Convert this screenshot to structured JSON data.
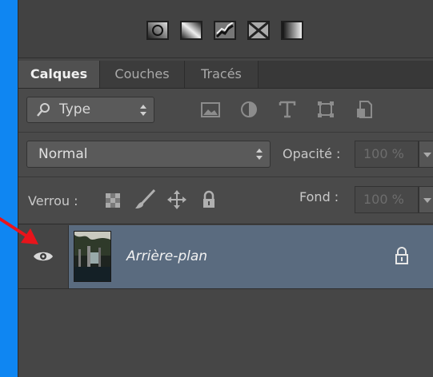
{
  "tabs": [
    {
      "label": "Calques",
      "active": true
    },
    {
      "label": "Couches",
      "active": false
    },
    {
      "label": "Tracés",
      "active": false
    }
  ],
  "filter": {
    "kind_label": "Type",
    "icons": [
      "image-filter-icon",
      "adjustment-filter-icon",
      "text-filter-icon",
      "shape-filter-icon",
      "smart-object-filter-icon"
    ]
  },
  "blend": {
    "mode": "Normal",
    "opacity_label": "Opacité :",
    "opacity_value": "100 %"
  },
  "lock": {
    "label": "Verrou :",
    "fill_label": "Fond :",
    "fill_value": "100 %"
  },
  "layer": {
    "name": "Arrière-plan",
    "visible": true,
    "locked": true
  },
  "colors": {
    "accent_blue": "#0f86f2",
    "panel_bg": "#454545",
    "selection": "#5a6b7f",
    "arrow": "#e8141b"
  }
}
